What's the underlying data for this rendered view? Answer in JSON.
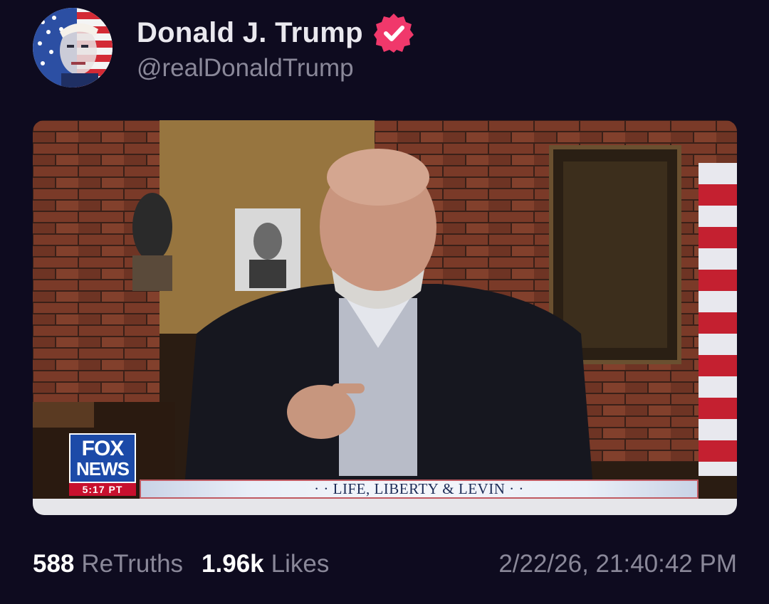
{
  "post": {
    "author": {
      "display_name": "Donald J. Trump",
      "handle": "@realDonaldTrump",
      "verified": true,
      "verified_color": "#f0386b",
      "avatar_icon": "american-flag-portrait"
    },
    "media": {
      "type": "video-still",
      "overlay": {
        "network_logo_top": "FOX",
        "network_logo_bottom": "NEWS",
        "time": "5:17 PT",
        "banner_text": "· · LIFE, LIBERTY & LEVIN · ·"
      }
    },
    "stats": {
      "retruths_count": "588",
      "retruths_label": "ReTruths",
      "likes_count": "1.96k",
      "likes_label": "Likes"
    },
    "timestamp": "2/22/26, 21:40:42 PM"
  },
  "colors": {
    "background": "#0e0b1f",
    "muted_text": "#8a8899",
    "primary_text": "#ffffff"
  }
}
